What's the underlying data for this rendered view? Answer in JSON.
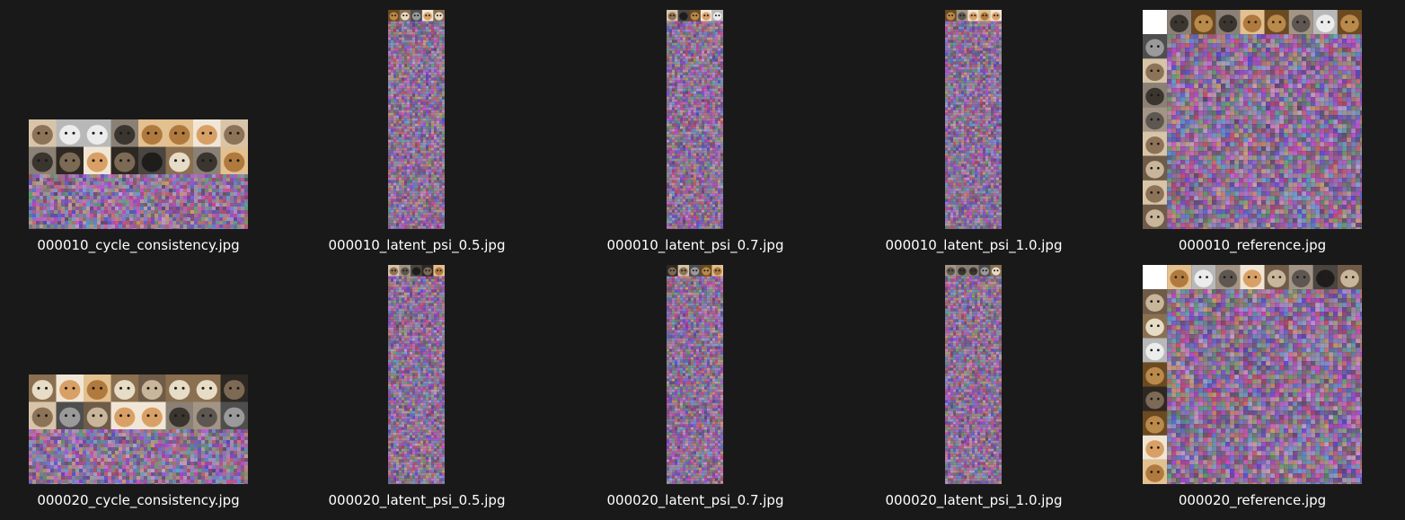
{
  "files": [
    {
      "id": "r1c1",
      "name": "000010_cycle_consistency.jpg",
      "kind": "cycle",
      "thumb_icon": "cycle-consistency-grid-thumbnail"
    },
    {
      "id": "r1c2",
      "name": "000010_latent_psi_0.5.jpg",
      "kind": "latent",
      "thumb_icon": "latent-strip-thumbnail"
    },
    {
      "id": "r1c3",
      "name": "000010_latent_psi_0.7.jpg",
      "kind": "latent",
      "thumb_icon": "latent-strip-thumbnail"
    },
    {
      "id": "r1c4",
      "name": "000010_latent_psi_1.0.jpg",
      "kind": "latent",
      "thumb_icon": "latent-strip-thumbnail"
    },
    {
      "id": "r1c5",
      "name": "000010_reference.jpg",
      "kind": "reference",
      "thumb_icon": "reference-grid-thumbnail"
    },
    {
      "id": "r2c1",
      "name": "000020_cycle_consistency.jpg",
      "kind": "cycle",
      "thumb_icon": "cycle-consistency-grid-thumbnail"
    },
    {
      "id": "r2c2",
      "name": "000020_latent_psi_0.5.jpg",
      "kind": "latent",
      "thumb_icon": "latent-strip-thumbnail"
    },
    {
      "id": "r2c3",
      "name": "000020_latent_psi_0.7.jpg",
      "kind": "latent",
      "thumb_icon": "latent-strip-thumbnail"
    },
    {
      "id": "r2c4",
      "name": "000020_latent_psi_1.0.jpg",
      "kind": "latent",
      "thumb_icon": "latent-strip-thumbnail"
    },
    {
      "id": "r2c5",
      "name": "000020_reference.jpg",
      "kind": "reference",
      "thumb_icon": "reference-grid-thumbnail"
    }
  ],
  "colors": {
    "background": "#191919",
    "caption_text": "#ffffff"
  }
}
